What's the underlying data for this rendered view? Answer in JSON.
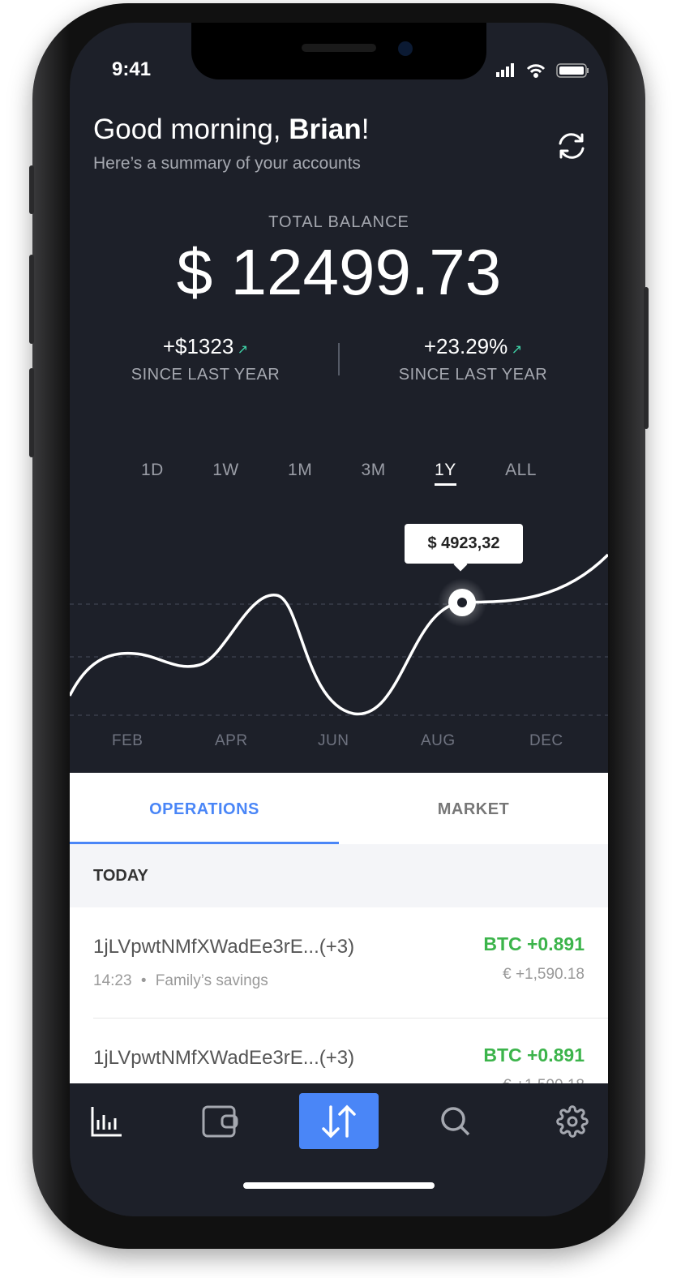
{
  "status_bar": {
    "time": "9:41"
  },
  "header": {
    "greeting_prefix": "Good morning, ",
    "name": "Brian",
    "greeting_suffix": "!",
    "subtitle": "Here’s a summary of your accounts"
  },
  "balance": {
    "label": "TOTAL BALANCE",
    "value": "$ 12499.73",
    "stats": [
      {
        "value": "+$1323",
        "label": "SINCE LAST YEAR"
      },
      {
        "value": "+23.29%",
        "label": "SINCE LAST YEAR"
      }
    ]
  },
  "timeframes": [
    {
      "label": "1D"
    },
    {
      "label": "1W"
    },
    {
      "label": "1M"
    },
    {
      "label": "3M"
    },
    {
      "label": "1Y",
      "active": true
    },
    {
      "label": "ALL"
    }
  ],
  "chart": {
    "tooltip": "$ 4923,32",
    "months": [
      "FEB",
      "APR",
      "JUN",
      "AUG",
      "DEC"
    ]
  },
  "tabs": [
    {
      "label": "OPERATIONS",
      "active": true
    },
    {
      "label": "MARKET"
    }
  ],
  "section": {
    "label": "TODAY"
  },
  "operations": [
    {
      "title": "1jLVpwtNMfXWadEe3rE...(+3)",
      "time": "14:23",
      "account": "Family’s savings",
      "crypto": "BTC +0.891",
      "fiat": "€ +1,590.18"
    },
    {
      "title": "1jLVpwtNMfXWadEe3rE...(+3)",
      "crypto": "BTC +0.891",
      "fiat": "€ +1,590.18"
    }
  ],
  "nav": [
    {
      "icon": "bar-chart-icon"
    },
    {
      "icon": "wallet-icon"
    },
    {
      "icon": "transfer-icon",
      "active": true
    },
    {
      "icon": "search-icon"
    },
    {
      "icon": "gear-icon"
    }
  ],
  "colors": {
    "accent": "#4a86f7",
    "positive": "#3cb44b",
    "trend": "#3fd3a8",
    "background": "#1d2029"
  }
}
